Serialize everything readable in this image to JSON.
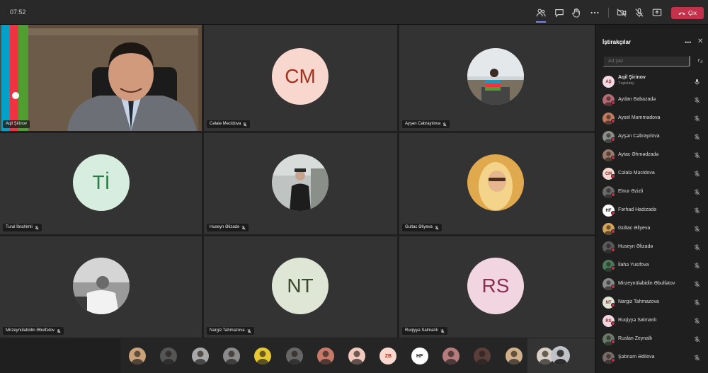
{
  "topbar": {
    "time": "07:52",
    "leave_label": "Çıx",
    "icons": [
      "participants-icon",
      "chat-icon",
      "raise-hand-icon",
      "more-icon",
      "camera-off-icon",
      "mic-off-icon",
      "share-icon",
      "phone-hangup-icon"
    ]
  },
  "tiles": [
    {
      "name": "Aqil Şirinov",
      "type": "video"
    },
    {
      "name": "Cəlalə Məcidova",
      "initials": "CM",
      "bg": "#f8d7cf",
      "fg": "#a2321f"
    },
    {
      "name": "Ayşən Cəbrayılova",
      "type": "photo"
    },
    {
      "name": "Tural İbrahimli",
      "initials": "Tİ",
      "bg": "#d6ede0",
      "fg": "#2e7a45"
    },
    {
      "name": "Huseyn Əlizadə",
      "type": "photo"
    },
    {
      "name": "Gultac Əliyeva",
      "type": "photo"
    },
    {
      "name": "Mirzeynüləbidin Əbulfətov",
      "type": "photo"
    },
    {
      "name": "Nargiz Tahmazova",
      "initials": "NT",
      "bg": "#dfe6d6",
      "fg": "#3b4a2e"
    },
    {
      "name": "Ruqiyyə Salmanlı",
      "initials": "RS",
      "bg": "#f1d5e0",
      "fg": "#8a2f52"
    }
  ],
  "bottom_strip": [
    "",
    "",
    "",
    "",
    "",
    "",
    "",
    "",
    "ZB",
    "HF",
    "",
    "",
    "",
    ""
  ],
  "panel": {
    "title": "İştirakçılar",
    "search_placeholder": "Ad yaz",
    "participants": [
      {
        "name": "Aqil Şirinov",
        "role": "Təşkilatçı",
        "initials": "AŞ",
        "bg": "#f2d9e4"
      },
      {
        "name": "Aydan Babazadə",
        "initials": "",
        "bg": "#b86a74"
      },
      {
        "name": "Aysel Məmmədova",
        "initials": "",
        "bg": "#c27a5f"
      },
      {
        "name": "Ayşən Cəbrayılova",
        "initials": "",
        "bg": "#8a8f8a"
      },
      {
        "name": "Aytac Əhmədzadə",
        "initials": "",
        "bg": "#9a7a6a"
      },
      {
        "name": "Cəlalə Məcidova",
        "initials": "CM",
        "bg": "#f8d7cf"
      },
      {
        "name": "Elnur Əzizli",
        "initials": "",
        "bg": "#6a6a6a"
      },
      {
        "name": "Fərhad Hadızadə",
        "initials": "HF",
        "bg": "#ffffff"
      },
      {
        "name": "Gültac Əliyeva",
        "initials": "",
        "bg": "#d4a45a"
      },
      {
        "name": "Huseyn Əlizadə",
        "initials": "",
        "bg": "#5a5a5a"
      },
      {
        "name": "İlahə Yusifova",
        "initials": "",
        "bg": "#4a7a5a"
      },
      {
        "name": "Mirzeynüləbidin Əbulfətov",
        "initials": "",
        "bg": "#8a8a8a"
      },
      {
        "name": "Nargiz Tahmazova",
        "initials": "NT",
        "bg": "#dfe6d6"
      },
      {
        "name": "Ruqiyyə Salmanlı",
        "initials": "RS",
        "bg": "#f1d5e0"
      },
      {
        "name": "Ruslan Zeynallı",
        "initials": "",
        "bg": "#6a7a6a"
      },
      {
        "name": "Şəbnəm Ədilova",
        "initials": "",
        "bg": "#7a6a6a"
      }
    ]
  }
}
